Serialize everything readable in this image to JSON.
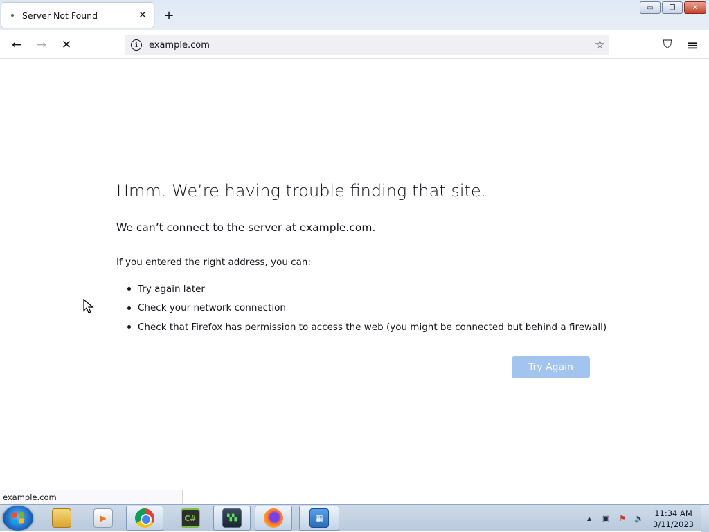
{
  "browser": {
    "tab": {
      "title": "Server Not Found",
      "close_glyph": "✕"
    },
    "new_tab_glyph": "+",
    "window_controls": {
      "minimize": "▭",
      "restore": "❐",
      "close": "✕"
    },
    "nav": {
      "back_glyph": "←",
      "forward_glyph": "→",
      "stop_glyph": "✕",
      "url": "example.com",
      "info_glyph": "i",
      "bookmark_glyph": "☆",
      "pocket_glyph": "⛉",
      "menu_glyph": "≡"
    }
  },
  "error_page": {
    "title": "Hmm. We’re having trouble finding that site.",
    "short_desc": "We can’t connect to the server at example.com.",
    "subhead": "If you entered the right address, you can:",
    "suggestions": [
      "Try again later",
      "Check your network connection",
      "Check that Firefox has permission to access the web (you might be connected but behind a firewall)"
    ],
    "try_again_label": "Try Again",
    "try_again_color": "#a4c4f0"
  },
  "status_text": "example.com",
  "taskbar": {
    "items": [
      {
        "name": "windows-explorer",
        "icon": "folder-icon",
        "glyph": ""
      },
      {
        "name": "media-player",
        "icon": "media-player-icon",
        "glyph": "▶"
      },
      {
        "name": "google-chrome",
        "icon": "chrome-icon",
        "glyph": ""
      },
      {
        "name": "csharp-app",
        "icon": "csharp-icon",
        "glyph": "C#"
      },
      {
        "name": "system-monitor",
        "icon": "monitor-icon",
        "glyph": "▚▚"
      },
      {
        "name": "firefox",
        "icon": "firefox-icon",
        "glyph": ""
      },
      {
        "name": "remote-desktop",
        "icon": "remote-desktop-icon",
        "glyph": "▦"
      }
    ],
    "tray": {
      "expand_glyph": "▲",
      "network_glyph": "▣",
      "action_center_glyph": "⚑",
      "volume_glyph": "🔈",
      "time": "11:34 AM",
      "date": "3/11/2023"
    }
  }
}
